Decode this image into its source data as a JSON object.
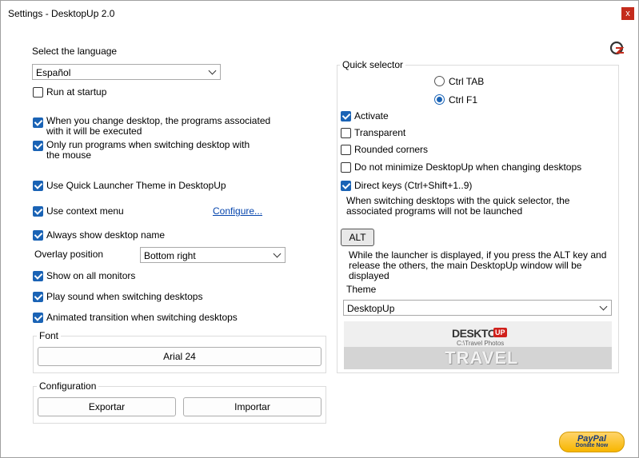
{
  "window": {
    "title": "Settings - DesktopUp 2.0",
    "close_glyph": "x"
  },
  "language": {
    "label": "Select the language",
    "value": "Español"
  },
  "options": {
    "run_at_startup": {
      "label": "Run at startup",
      "checked": false
    },
    "run_programs": {
      "label": "When you change desktop, the programs associated with it will be executed",
      "checked": true
    },
    "only_run_mouse": {
      "label": "Only run programs when switching desktop with the mouse",
      "checked": true
    },
    "quick_launcher_theme": {
      "label": "Use Quick Launcher Theme in DesktopUp",
      "checked": true
    },
    "context_menu": {
      "label": "Use context menu",
      "checked": true,
      "configure_link": "Configure..."
    },
    "always_show_name": {
      "label": "Always show desktop name",
      "checked": true
    },
    "overlay_position": {
      "label": "Overlay position",
      "value": "Bottom right"
    },
    "show_all_monitors": {
      "label": "Show on all monitors",
      "checked": true
    },
    "play_sound": {
      "label": "Play sound when switching desktops",
      "checked": true
    },
    "animated_transition": {
      "label": "Animated transition when switching desktops",
      "checked": true
    }
  },
  "font_group": {
    "title": "Font",
    "button": "Arial 24"
  },
  "config_group": {
    "title": "Configuration",
    "export_button": "Exportar",
    "import_button": "Importar"
  },
  "quick_selector": {
    "title": "Quick selector",
    "radio_ctrl_tab": {
      "label": "Ctrl TAB",
      "selected": false
    },
    "radio_ctrl_f1": {
      "label": "Ctrl F1",
      "selected": true
    },
    "activate": {
      "label": "Activate",
      "checked": true
    },
    "transparent": {
      "label": "Transparent",
      "checked": false
    },
    "rounded_corners": {
      "label": "Rounded corners",
      "checked": false
    },
    "no_minimize": {
      "label": "Do not minimize DesktopUp when changing desktops",
      "checked": false
    },
    "direct_keys": {
      "label": "Direct keys (Ctrl+Shift+1..9)",
      "checked": true
    },
    "direct_keys_note": "When switching desktops with the quick selector, the associated programs will not be launched",
    "alt_button": "ALT",
    "alt_note": "While the launcher is displayed, if you press the ALT key and release the others, the main DesktopUp window will be displayed",
    "theme_label": "Theme",
    "theme_value": "DesktopUp",
    "preview": {
      "logo_text": "DESKTOP",
      "logo_badge": "UP",
      "path": "C:\\Travel Photos",
      "name": "TRAVEL"
    }
  },
  "paypal": {
    "brand": "PayPal",
    "sub": "Donate Now"
  },
  "colors": {
    "accent": "#1a63b5",
    "close": "#c42b1c",
    "paypal_yellow": "#f7b600"
  }
}
